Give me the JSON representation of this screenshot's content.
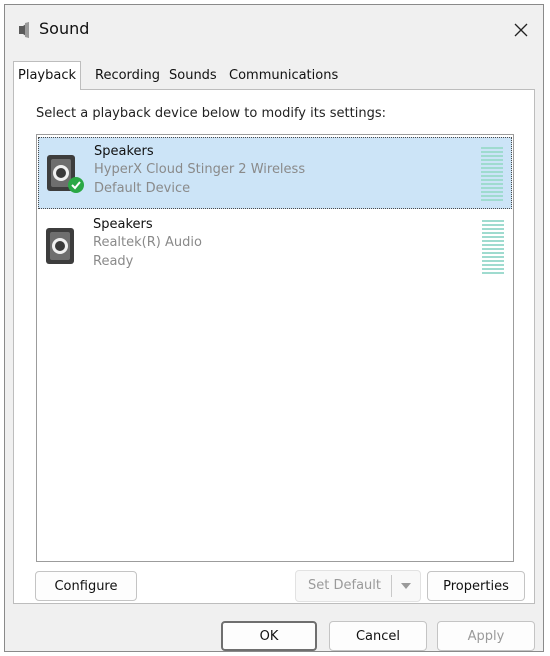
{
  "window": {
    "title": "Sound",
    "close_icon": "close-icon"
  },
  "tabs": [
    {
      "label": "Playback",
      "selected": true
    },
    {
      "label": "Recording",
      "selected": false
    },
    {
      "label": "Sounds",
      "selected": false
    },
    {
      "label": "Communications",
      "selected": false
    }
  ],
  "panel": {
    "instruction": "Select a playback device below to modify its settings:"
  },
  "devices": [
    {
      "name": "Speakers",
      "description": "HyperX Cloud Stinger 2 Wireless",
      "status": "Default Device",
      "icon": "speaker-icon",
      "default_badge_icon": "green-check-icon",
      "selected": true
    },
    {
      "name": "Speakers",
      "description": "Realtek(R) Audio",
      "status": "Ready",
      "icon": "speaker-icon",
      "selected": false
    }
  ],
  "buttons": {
    "configure": "Configure",
    "set_default": "Set Default",
    "set_default_disabled": true,
    "properties": "Properties",
    "ok": "OK",
    "cancel": "Cancel",
    "apply": "Apply",
    "apply_disabled": true
  },
  "colors": {
    "selection": "#cce4f7",
    "meter": "#9fdbcf",
    "check": "#2aa845"
  }
}
